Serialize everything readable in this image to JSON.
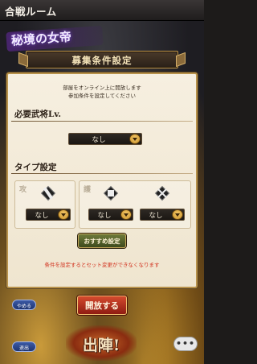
{
  "window": {
    "title": "合戦ルーム"
  },
  "logo": {
    "text": "秘境の女帝"
  },
  "dialog": {
    "title": "募集条件設定",
    "description_lines": [
      "部屋をオンライン上に開放します",
      "参加条件を設定してください"
    ]
  },
  "required_level": {
    "label": "必要武将Lv.",
    "selected": "なし"
  },
  "type_settings": {
    "label": "タイプ設定",
    "attack": {
      "label": "攻",
      "selected": "なし",
      "icon": "attack-type-icon"
    },
    "defense": {
      "label": "護",
      "selected": "なし",
      "icon": "defense-type-icon"
    },
    "other": {
      "selected": "なし",
      "icon": "special-type-icon"
    }
  },
  "recommend_button": "おすすめ設定",
  "warning": "条件を設定するとセット変更ができなくなります",
  "buttons": {
    "quit": "やめる",
    "open": "開放する",
    "cancel": "退出",
    "deploy": "出陣!",
    "chat": "•••"
  },
  "colors": {
    "warning": "#d2321e",
    "accent_gold": "#c79b4d",
    "open_button": "#b8321c"
  }
}
